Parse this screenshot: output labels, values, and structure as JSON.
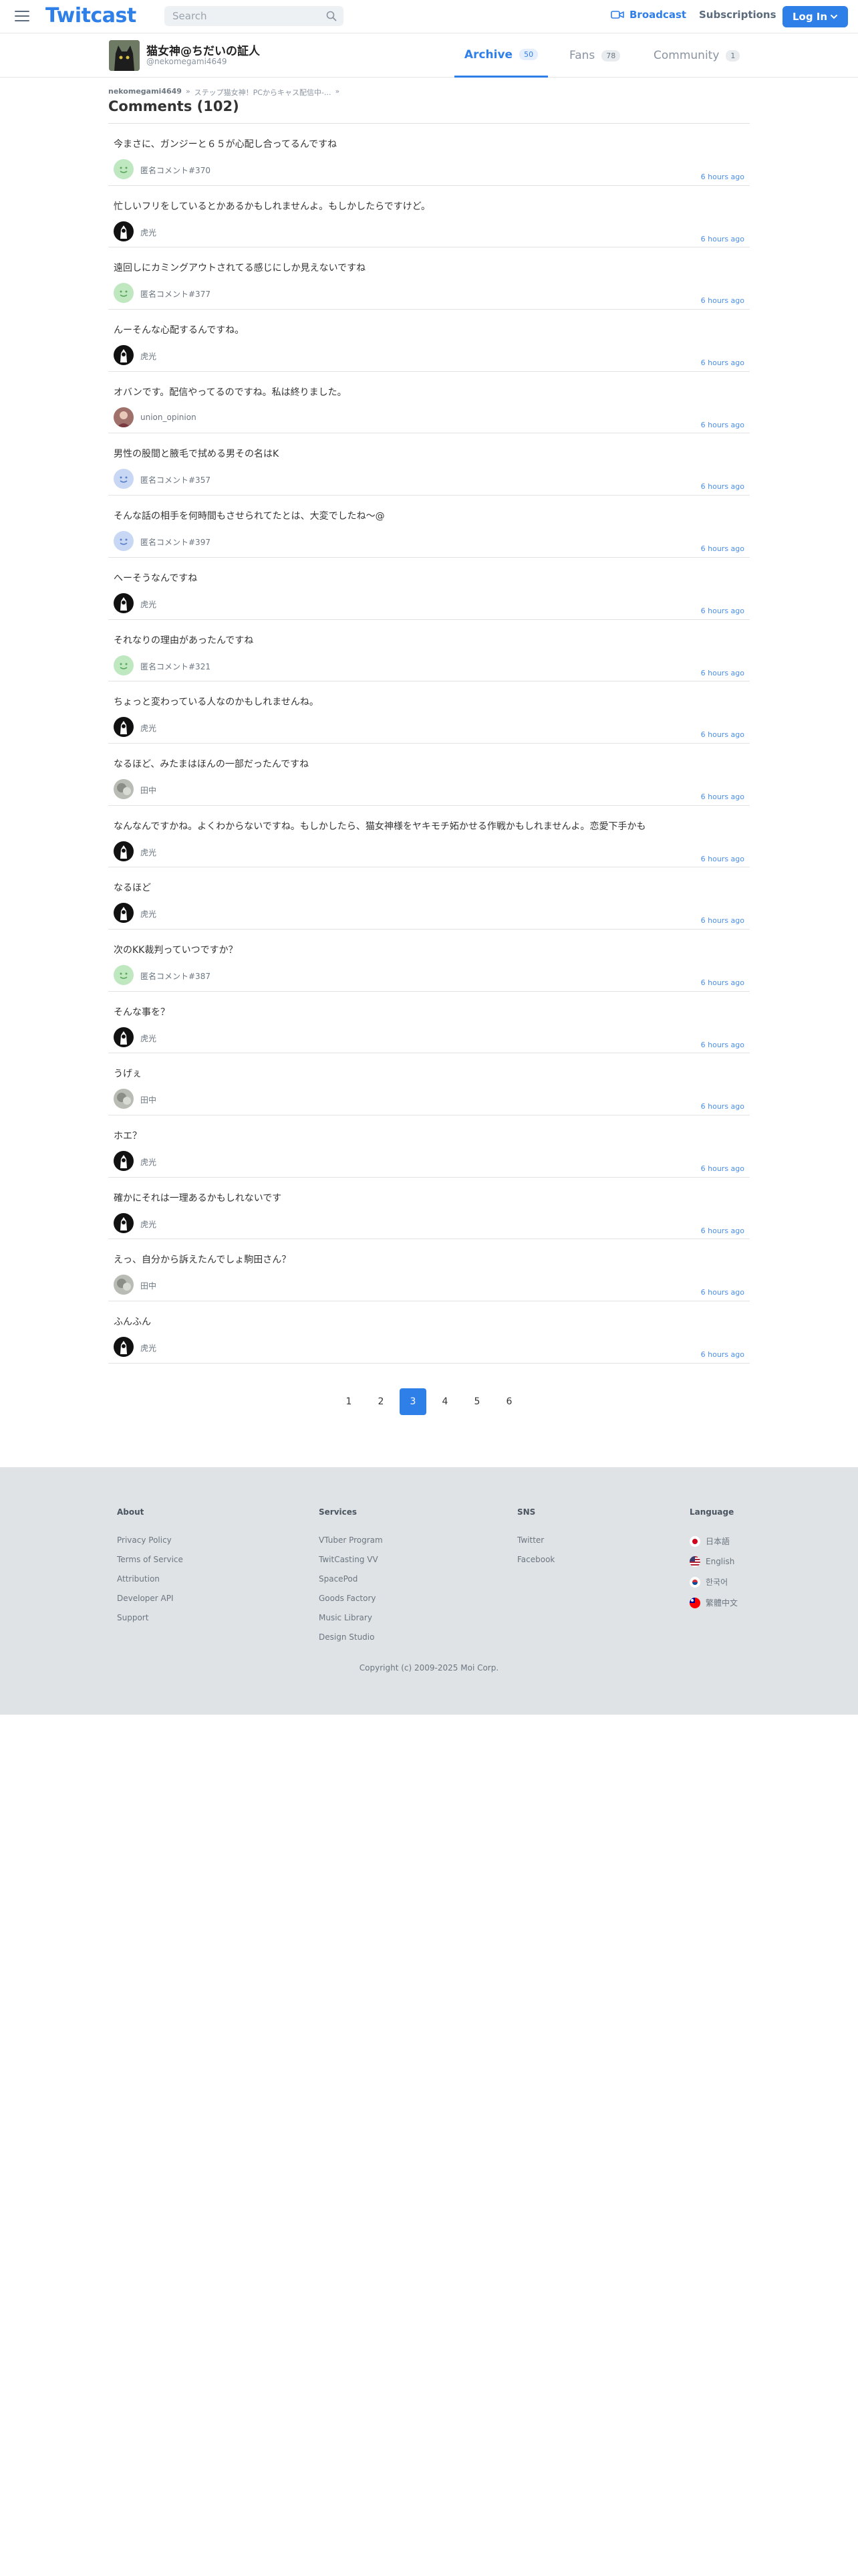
{
  "header": {
    "logo": "Twitcast",
    "search_placeholder": "Search",
    "broadcast_label": "Broadcast",
    "subscriptions_label": "Subscriptions",
    "login_label": "Log In"
  },
  "profile": {
    "name": "猫女神@ちだいの証人",
    "handle": "@nekomegami4649",
    "tabs": [
      {
        "label": "Archive",
        "count": "50"
      },
      {
        "label": "Fans",
        "count": "78"
      },
      {
        "label": "Community",
        "count": "1"
      }
    ]
  },
  "breadcrumb": {
    "user": "nekomegami4649",
    "sep1": "»",
    "movie": "ステップ猫女神！PCからキャス配信中-...",
    "sep2": "»"
  },
  "page_title": "Comments (102)",
  "comments": [
    {
      "text": "今まさに、ガンジーと６５が心配し合ってるんですね",
      "user": "匿名コメント#370",
      "time": "6 hours ago",
      "avatar": "anon-green"
    },
    {
      "text": "忙しいフリをしているとかあるかもしれませんよ。もしかしたらですけど。",
      "user": "虎光",
      "time": "6 hours ago",
      "avatar": "dark"
    },
    {
      "text": "遠回しにカミングアウトされてる感じにしか見えないですね",
      "user": "匿名コメント#377",
      "time": "6 hours ago",
      "avatar": "anon-green"
    },
    {
      "text": "んーそんな心配するんですね。",
      "user": "虎光",
      "time": "6 hours ago",
      "avatar": "dark"
    },
    {
      "text": "オバンです。配信やってるのですね。私は終りました。",
      "user": "union_opinion",
      "time": "6 hours ago",
      "avatar": "photo"
    },
    {
      "text": "男性の股間と腋毛で拭める男その名はK",
      "user": "匿名コメント#357",
      "time": "6 hours ago",
      "avatar": "anon-blue"
    },
    {
      "text": "そんな話の相手を何時間もさせられてたとは、大変でしたね〜@",
      "user": "匿名コメント#397",
      "time": "6 hours ago",
      "avatar": "anon-blue"
    },
    {
      "text": "へーそうなんですね",
      "user": "虎光",
      "time": "6 hours ago",
      "avatar": "dark"
    },
    {
      "text": "それなりの理由があったんですね",
      "user": "匿名コメント#321",
      "time": "6 hours ago",
      "avatar": "anon-green"
    },
    {
      "text": "ちょっと変わっている人なのかもしれませんね。",
      "user": "虎光",
      "time": "6 hours ago",
      "avatar": "dark"
    },
    {
      "text": "なるほど、みたまはほんの一部だったんですね",
      "user": "田中",
      "time": "6 hours ago",
      "avatar": "gray"
    },
    {
      "text": "なんなんですかね。よくわからないですね。もしかしたら、猫女神様をヤキモチ妬かせる作戦かもしれませんよ。恋愛下手かも",
      "user": "虎光",
      "time": "6 hours ago",
      "avatar": "dark"
    },
    {
      "text": "なるほど",
      "user": "虎光",
      "time": "6 hours ago",
      "avatar": "dark"
    },
    {
      "text": "次のKK裁判っていつですか？",
      "user": "匿名コメント#387",
      "time": "6 hours ago",
      "avatar": "anon-green"
    },
    {
      "text": "そんな事を？",
      "user": "虎光",
      "time": "6 hours ago",
      "avatar": "dark"
    },
    {
      "text": "うげぇ",
      "user": "田中",
      "time": "6 hours ago",
      "avatar": "gray"
    },
    {
      "text": "ホエ？",
      "user": "虎光",
      "time": "6 hours ago",
      "avatar": "dark"
    },
    {
      "text": "確かにそれは一理あるかもしれないです",
      "user": "虎光",
      "time": "6 hours ago",
      "avatar": "dark"
    },
    {
      "text": "えっ、自分から訴えたんでしょ駒田さん？",
      "user": "田中",
      "time": "6 hours ago",
      "avatar": "gray"
    },
    {
      "text": "ふんふん",
      "user": "虎光",
      "time": "6 hours ago",
      "avatar": "dark"
    }
  ],
  "pagination": {
    "pages": [
      "1",
      "2",
      "3",
      "4",
      "5",
      "6"
    ],
    "current": "3"
  },
  "footer": {
    "about": {
      "title": "About",
      "links": [
        "Privacy Policy",
        "Terms of Service",
        "Attribution",
        "Developer API",
        "Support"
      ]
    },
    "services": {
      "title": "Services",
      "links": [
        "VTuber Program",
        "TwitCasting VV",
        "SpacePod",
        "Goods Factory",
        "Music Library",
        "Design Studio"
      ]
    },
    "sns": {
      "title": "SNS",
      "links": [
        "Twitter",
        "Facebook"
      ]
    },
    "language": {
      "title": "Language",
      "items": [
        "日本語",
        "English",
        "한국어",
        "繁體中文"
      ]
    },
    "copyright": "Copyright (c) 2009-2025 Moi Corp."
  },
  "colors": {
    "accent": "#2f7fe8",
    "footer_bg": "#dfe3e6",
    "time_link": "#4a8ee8"
  }
}
